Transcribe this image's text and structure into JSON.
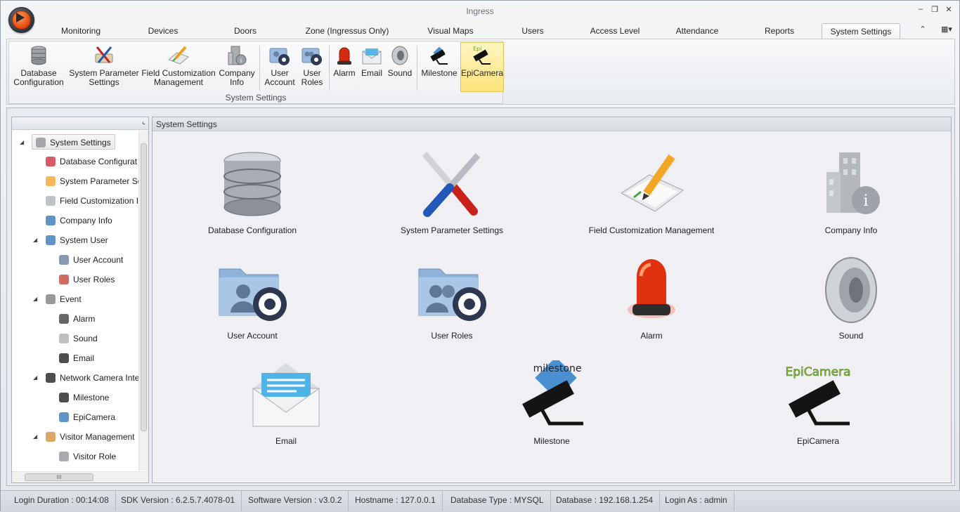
{
  "window": {
    "title": "Ingress"
  },
  "tabs": [
    "Monitoring",
    "Devices",
    "Doors",
    "Zone (Ingressus Only)",
    "Visual Maps",
    "Users",
    "Access Level",
    "Attendance",
    "Reports",
    "System Settings"
  ],
  "active_tab": "System Settings",
  "ribbon": {
    "group_label": "System Settings",
    "buttons": [
      {
        "line1": "Database",
        "line2": "Configuration",
        "icon": "database-icon"
      },
      {
        "line1": "System Parameter",
        "line2": "Settings",
        "icon": "tools-icon"
      },
      {
        "line1": "Field Customization",
        "line2": "Management",
        "icon": "edit-pencil-icon"
      },
      {
        "line1": "Company",
        "line2": "Info",
        "icon": "building-info-icon"
      },
      {
        "line1": "User",
        "line2": "Account",
        "icon": "user-account-icon"
      },
      {
        "line1": "User",
        "line2": "Roles",
        "icon": "user-roles-icon"
      },
      {
        "line1": "Alarm",
        "line2": "",
        "icon": "alarm-icon"
      },
      {
        "line1": "Email",
        "line2": "",
        "icon": "email-icon"
      },
      {
        "line1": "Sound",
        "line2": "",
        "icon": "speaker-icon"
      },
      {
        "line1": "Milestone",
        "line2": "",
        "icon": "camera-icon"
      },
      {
        "line1": "EpiCamera",
        "line2": "",
        "icon": "epicamera-icon"
      }
    ]
  },
  "tree": {
    "nodes": [
      {
        "label": "System Settings",
        "level": 0,
        "expander": "◢"
      },
      {
        "label": "Database Configurat",
        "level": 1,
        "expander": ""
      },
      {
        "label": "System Parameter Se",
        "level": 1,
        "expander": ""
      },
      {
        "label": "Field Customization I",
        "level": 1,
        "expander": ""
      },
      {
        "label": "Company Info",
        "level": 1,
        "expander": ""
      },
      {
        "label": "System User",
        "level": 1,
        "expander": "◢"
      },
      {
        "label": "User Account",
        "level": 2,
        "expander": ""
      },
      {
        "label": "User Roles",
        "level": 2,
        "expander": ""
      },
      {
        "label": "Event",
        "level": 1,
        "expander": "◢"
      },
      {
        "label": "Alarm",
        "level": 2,
        "expander": ""
      },
      {
        "label": "Sound",
        "level": 2,
        "expander": ""
      },
      {
        "label": "Email",
        "level": 2,
        "expander": ""
      },
      {
        "label": "Network Camera Inte",
        "level": 1,
        "expander": "◢"
      },
      {
        "label": "Milestone",
        "level": 2,
        "expander": ""
      },
      {
        "label": "EpiCamera",
        "level": 2,
        "expander": ""
      },
      {
        "label": "Visitor Management",
        "level": 1,
        "expander": "◢"
      },
      {
        "label": "Visitor Role",
        "level": 2,
        "expander": ""
      }
    ]
  },
  "main": {
    "header": "System Settings",
    "items": [
      "Database Configuration",
      "System Parameter Settings",
      "Field Customization Management",
      "Company Info",
      "User Account",
      "User Roles",
      "Alarm",
      "Sound",
      "Email",
      "Milestone",
      "EpiCamera"
    ],
    "brand_milestone": "milestone",
    "brand_epicamera": "EpiCamera"
  },
  "status": [
    "Login Duration : 00:14:08",
    "SDK Version : 6.2.5.7.4078-01",
    "Software Version : v3.0.2",
    "Hostname : 127.0.0.1",
    "Database Type : MYSQL",
    "Database : 192.168.1.254",
    "Login As : admin"
  ],
  "colors": {
    "accent_orange": "#e0450d",
    "selected_yellow": "#ffe27a",
    "alarm_red": "#d42a10",
    "folder_blue": "#8fb3d9"
  }
}
